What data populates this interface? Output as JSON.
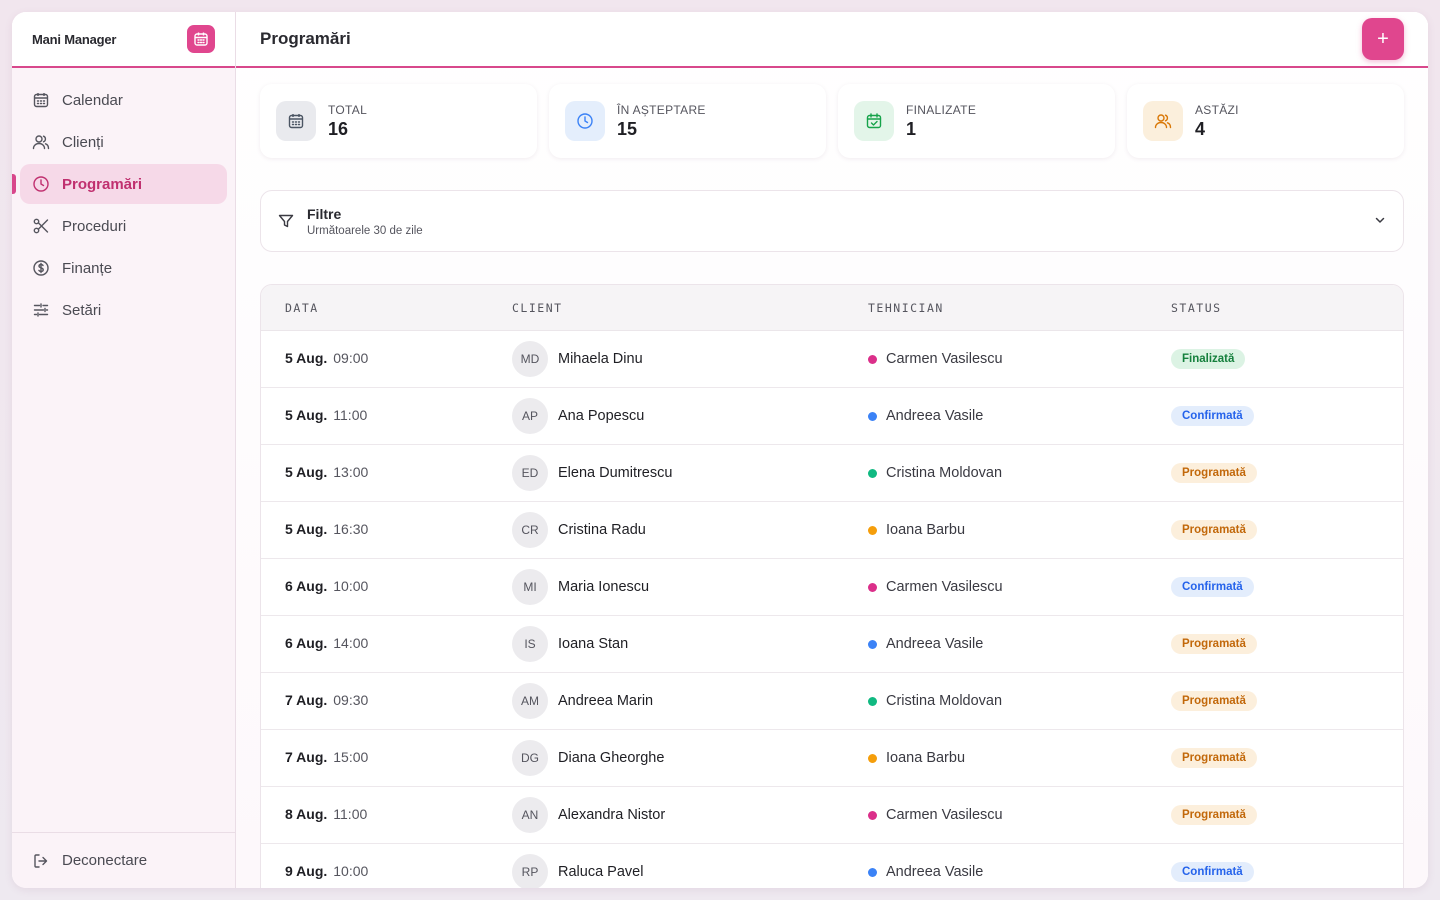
{
  "brand": {
    "name": "Mani Manager",
    "icon": "calendar-icon",
    "accent": "#e0468e"
  },
  "sidebar": {
    "items": [
      {
        "label": "Calendar",
        "icon": "calendar-icon",
        "active": false
      },
      {
        "label": "Clienți",
        "icon": "users-icon",
        "active": false
      },
      {
        "label": "Programări",
        "icon": "clock-icon",
        "active": true
      },
      {
        "label": "Proceduri",
        "icon": "scissors-icon",
        "active": false
      },
      {
        "label": "Finanțe",
        "icon": "dollar-icon",
        "active": false
      },
      {
        "label": "Setări",
        "icon": "sliders-icon",
        "active": false
      }
    ],
    "logout_label": "Deconectare"
  },
  "header": {
    "title": "Programări",
    "add_label": "+"
  },
  "stats": [
    {
      "label": "TOTAL",
      "value": "16",
      "icon": "calendar-icon",
      "color": "#4b5563",
      "bg": "#e9eaee"
    },
    {
      "label": "ÎN AȘTEPTARE",
      "value": "15",
      "icon": "clock-icon",
      "color": "#3b82f6",
      "bg": "#e4eefc"
    },
    {
      "label": "FINALIZATE",
      "value": "1",
      "icon": "calendar-check-icon",
      "color": "#16a34a",
      "bg": "#e3f5e9"
    },
    {
      "label": "ASTĂZI",
      "value": "4",
      "icon": "users-icon",
      "color": "#d97706",
      "bg": "#fbefdc"
    }
  ],
  "filters": {
    "title": "Filtre",
    "subtitle": "Următoarele 30 de zile"
  },
  "table": {
    "columns": [
      "DATA",
      "CLIENT",
      "TEHNICIAN",
      "STATUS"
    ],
    "rows": [
      {
        "date": "5 Aug.",
        "time": "09:00",
        "initials": "MD",
        "client": "Mihaela Dinu",
        "tech": "Carmen Vasilescu",
        "tech_color": "#db2f8a",
        "status": "Finalizată",
        "status_kind": "done"
      },
      {
        "date": "5 Aug.",
        "time": "11:00",
        "initials": "AP",
        "client": "Ana Popescu",
        "tech": "Andreea Vasile",
        "tech_color": "#3b82f6",
        "status": "Confirmată",
        "status_kind": "confirmed"
      },
      {
        "date": "5 Aug.",
        "time": "13:00",
        "initials": "ED",
        "client": "Elena Dumitrescu",
        "tech": "Cristina Moldovan",
        "tech_color": "#10b981",
        "status": "Programată",
        "status_kind": "scheduled"
      },
      {
        "date": "5 Aug.",
        "time": "16:30",
        "initials": "CR",
        "client": "Cristina Radu",
        "tech": "Ioana Barbu",
        "tech_color": "#f59e0b",
        "status": "Programată",
        "status_kind": "scheduled"
      },
      {
        "date": "6 Aug.",
        "time": "10:00",
        "initials": "MI",
        "client": "Maria Ionescu",
        "tech": "Carmen Vasilescu",
        "tech_color": "#db2f8a",
        "status": "Confirmată",
        "status_kind": "confirmed"
      },
      {
        "date": "6 Aug.",
        "time": "14:00",
        "initials": "IS",
        "client": "Ioana Stan",
        "tech": "Andreea Vasile",
        "tech_color": "#3b82f6",
        "status": "Programată",
        "status_kind": "scheduled"
      },
      {
        "date": "7 Aug.",
        "time": "09:30",
        "initials": "AM",
        "client": "Andreea Marin",
        "tech": "Cristina Moldovan",
        "tech_color": "#10b981",
        "status": "Programată",
        "status_kind": "scheduled"
      },
      {
        "date": "7 Aug.",
        "time": "15:00",
        "initials": "DG",
        "client": "Diana Gheorghe",
        "tech": "Ioana Barbu",
        "tech_color": "#f59e0b",
        "status": "Programată",
        "status_kind": "scheduled"
      },
      {
        "date": "8 Aug.",
        "time": "11:00",
        "initials": "AN",
        "client": "Alexandra Nistor",
        "tech": "Carmen Vasilescu",
        "tech_color": "#db2f8a",
        "status": "Programată",
        "status_kind": "scheduled"
      },
      {
        "date": "9 Aug.",
        "time": "10:00",
        "initials": "RP",
        "client": "Raluca Pavel",
        "tech": "Andreea Vasile",
        "tech_color": "#3b82f6",
        "status": "Confirmată",
        "status_kind": "confirmed"
      }
    ]
  },
  "status_colors": {
    "done": {
      "fg": "#15803d",
      "bg": "#dcf3e4"
    },
    "confirmed": {
      "fg": "#2563eb",
      "bg": "#e3edfc"
    },
    "scheduled": {
      "fg": "#c2680a",
      "bg": "#fcefdc"
    }
  }
}
